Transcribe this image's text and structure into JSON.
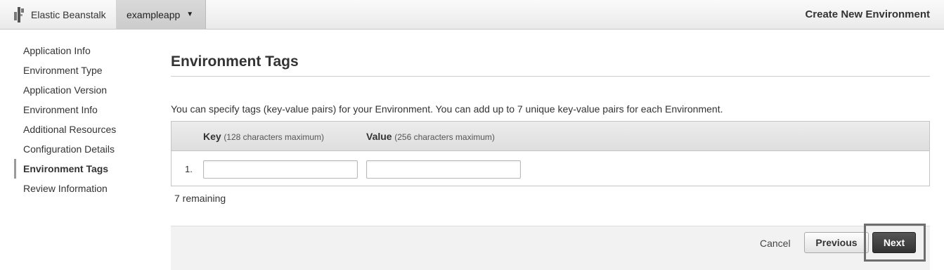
{
  "header": {
    "brand": "Elastic Beanstalk",
    "app_name": "exampleapp",
    "page_title": "Create New Environment"
  },
  "sidebar": {
    "items": [
      {
        "label": "Application Info"
      },
      {
        "label": "Environment Type"
      },
      {
        "label": "Application Version"
      },
      {
        "label": "Environment Info"
      },
      {
        "label": "Additional Resources"
      },
      {
        "label": "Configuration Details"
      },
      {
        "label": "Environment Tags",
        "active": true
      },
      {
        "label": "Review Information"
      }
    ]
  },
  "main": {
    "title": "Environment Tags",
    "intro": "You can specify tags (key-value pairs) for your Environment. You can add up to 7 unique key-value pairs for each Environment.",
    "table": {
      "key_header": "Key",
      "key_hint": "(128 characters maximum)",
      "value_header": "Value",
      "value_hint": "(256 characters maximum)",
      "rows": [
        {
          "num": "1.",
          "key": "",
          "value": ""
        }
      ]
    },
    "remaining": "7 remaining"
  },
  "footer": {
    "cancel": "Cancel",
    "previous": "Previous",
    "next": "Next"
  },
  "colors": {
    "next_button": "#3c3c3c",
    "highlight_border": "#6e6e6e"
  }
}
